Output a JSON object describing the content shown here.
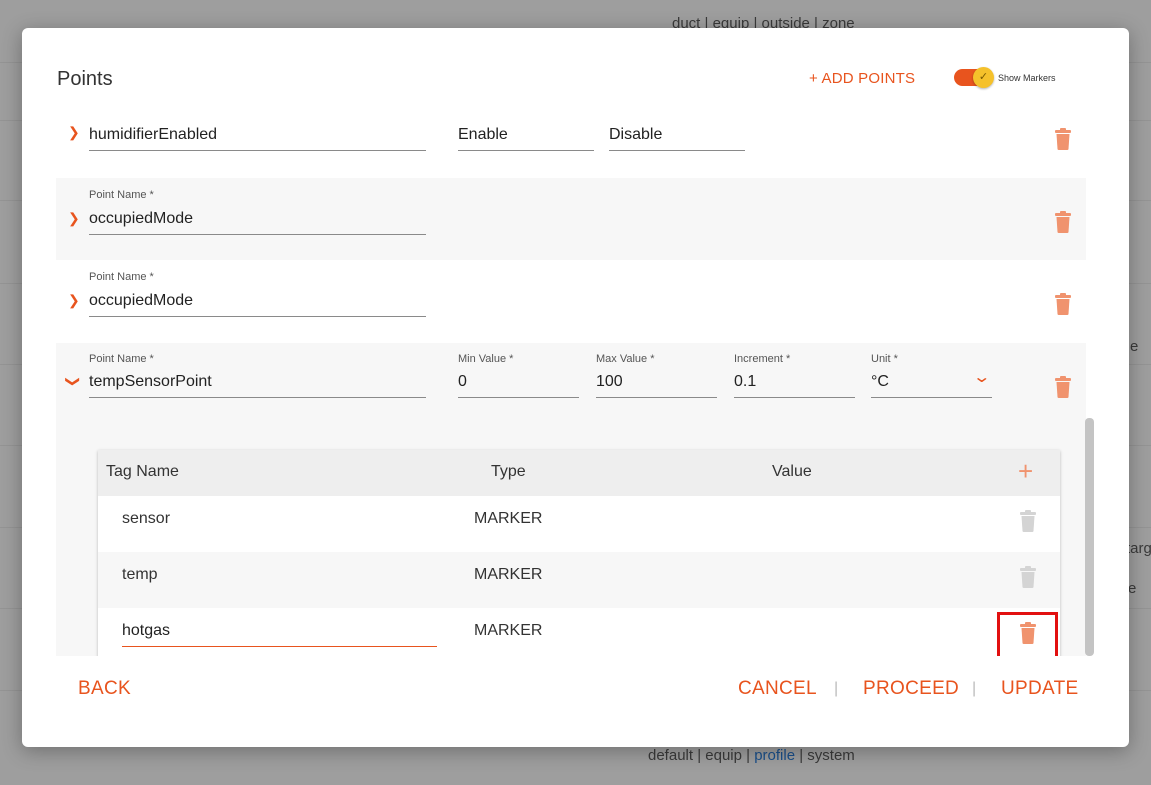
{
  "background": {
    "top_filter": "duct | equip | outside | zone",
    "bottom_filter_parts": [
      "default | equip | ",
      "profile",
      " | system"
    ],
    "right_fragments": [
      "e",
      "targ",
      "e"
    ]
  },
  "modal": {
    "title": "Points",
    "add_points_label": "+ ADD POINTS",
    "show_markers_label": "Show Markers",
    "show_markers_on": true
  },
  "points": [
    {
      "name": "humidifierEnabled",
      "expanded": false,
      "enable_label": "Enable",
      "disable_label": "Disable"
    },
    {
      "name_label": "Point Name *",
      "name": "occupiedMode",
      "expanded": false
    },
    {
      "name_label": "Point Name *",
      "name": "occupiedMode",
      "expanded": false
    },
    {
      "name_label": "Point Name *",
      "name": "tempSensorPoint",
      "expanded": true,
      "min_label": "Min Value *",
      "min_value": "0",
      "max_label": "Max Value *",
      "max_value": "100",
      "increment_label": "Increment *",
      "increment_value": "0.1",
      "unit_label": "Unit *",
      "unit_value": "°C"
    }
  ],
  "tags_table": {
    "headers": {
      "tag_name": "Tag Name",
      "type": "Type",
      "value": "Value"
    },
    "rows": [
      {
        "tag_name": "sensor",
        "type": "MARKER",
        "value": ""
      },
      {
        "tag_name": "temp",
        "type": "MARKER",
        "value": ""
      },
      {
        "tag_name": "hotgas",
        "type": "MARKER",
        "value": ""
      }
    ]
  },
  "footer": {
    "back_label": "BACK",
    "cancel_label": "CANCEL",
    "proceed_label": "PROCEED",
    "update_label": "UPDATE",
    "separator": "|"
  },
  "colors": {
    "accent": "#e8541e",
    "trash_active": "#f0936e",
    "trash_disabled": "#d4d4d4",
    "highlight": "#e21010"
  }
}
